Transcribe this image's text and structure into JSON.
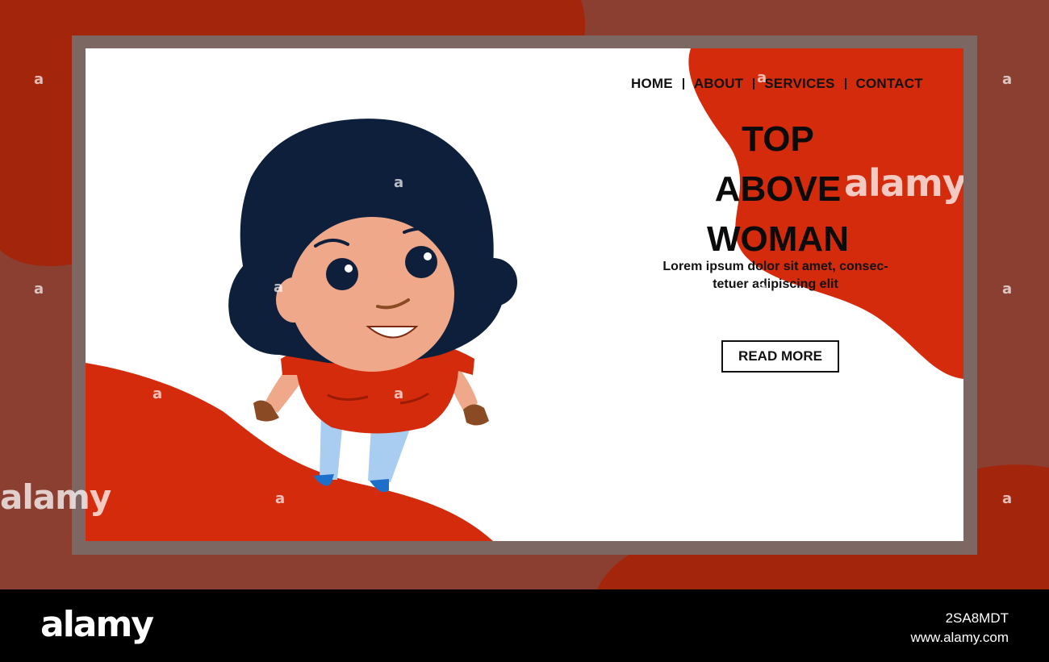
{
  "nav": {
    "items": [
      {
        "label": "HOME"
      },
      {
        "label": "ABOUT"
      },
      {
        "label": "SERVICES"
      },
      {
        "label": "CONTACT"
      }
    ]
  },
  "hero": {
    "title_lines": [
      "TOP",
      "ABOVE",
      "WOMAN"
    ],
    "subtext_line1": "Lorem ipsum dolor sit amet, consec-",
    "subtext_line2": "tetuer adipiscing elit",
    "cta_label": "READ MORE"
  },
  "watermark": {
    "text": "alamy",
    "letter": "a"
  },
  "footer": {
    "logo": "alamy",
    "image_id": "2SA8MDT",
    "site": "www.alamy.com"
  },
  "colors": {
    "accent_red": "#d42b0c",
    "dark_red": "#a3250b",
    "frame_brown": "#8a3f31",
    "hair": "#0d1f3a",
    "skin": "#f0a88a"
  }
}
